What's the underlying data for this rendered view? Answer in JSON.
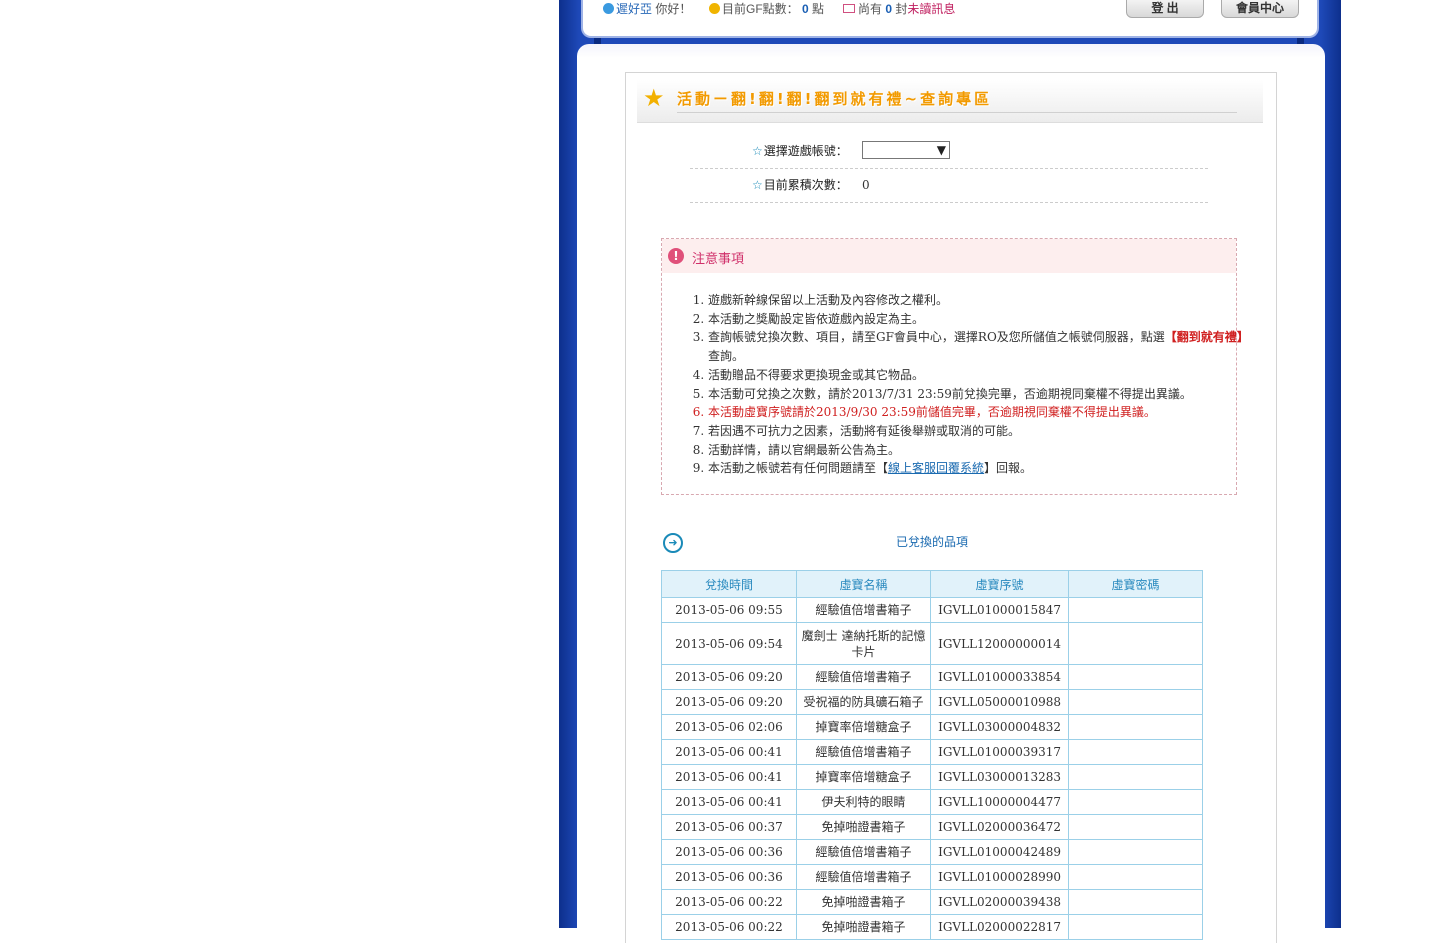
{
  "topbar": {
    "username": "遲好亞",
    "greeting": "你好！",
    "points_label": "目前GF點數：",
    "points_value": "0",
    "points_unit": "點",
    "mail_prefix": "尚有",
    "mail_count": "0",
    "mail_unit": "封",
    "mail_unread": "未讀訊息",
    "logout_label": "登 出",
    "member_center_label": "會員中心"
  },
  "header": {
    "title": "活動ㄧ翻!翻!翻!翻到就有禮~查詢專區"
  },
  "form": {
    "account_label": "選擇遊戲帳號：",
    "account_selected": "",
    "count_label": "目前累積次數：",
    "count_value": "0"
  },
  "notice": {
    "title": "注意事項",
    "item1": "遊戲新幹線保留以上活動及內容修改之權利。",
    "item2": "本活動之獎勵設定皆依遊戲內設定為主。",
    "item3_a": "查詢帳號兌換次數、項目，請至GF會員中心，選擇RO及您所儲值之帳號伺服器，點選",
    "item3_b": "【翻到就有禮】",
    "item3_c": "查詢。",
    "item4": "活動贈品不得要求更換現金或其它物品。",
    "item5": "本活動可兌換之次數，請於2013/7/31 23:59前兌換完畢，否逾期視同棄權不得提出異議。",
    "item6": "本活動虛寶序號請於2013/9/30 23:59前儲值完畢，否逾期視同棄權不得提出異議。",
    "item7": "若因遇不可抗力之因素，活動將有延後舉辦或取消的可能。",
    "item8": "活動詳情，請以官網最新公告為主。",
    "item9_a": "本活動之帳號若有任何問題請至【",
    "item9_link": "線上客服回覆系統",
    "item9_b": "】回報。"
  },
  "redeemed": {
    "title": "已兌換的品項",
    "columns": [
      "兌換時間",
      "虛寶名稱",
      "虛寶序號",
      "虛寶密碼"
    ],
    "rows": [
      {
        "time": "2013-05-06 09:55",
        "name": "經驗值倍增書箱子",
        "serial": "IGVLL01000015847",
        "password": ""
      },
      {
        "time": "2013-05-06 09:54",
        "name": "魔劍士 達納托斯的記憶卡片",
        "serial": "IGVLL12000000014",
        "password": ""
      },
      {
        "time": "2013-05-06 09:20",
        "name": "經驗值倍增書箱子",
        "serial": "IGVLL01000033854",
        "password": ""
      },
      {
        "time": "2013-05-06 09:20",
        "name": "受祝福的防具礦石箱子",
        "serial": "IGVLL05000010988",
        "password": ""
      },
      {
        "time": "2013-05-06 02:06",
        "name": "掉寶率倍增糖盒子",
        "serial": "IGVLL03000004832",
        "password": ""
      },
      {
        "time": "2013-05-06 00:41",
        "name": "經驗值倍增書箱子",
        "serial": "IGVLL01000039317",
        "password": ""
      },
      {
        "time": "2013-05-06 00:41",
        "name": "掉寶率倍增糖盒子",
        "serial": "IGVLL03000013283",
        "password": ""
      },
      {
        "time": "2013-05-06 00:41",
        "name": "伊夫利特的眼睛",
        "serial": "IGVLL10000004477",
        "password": ""
      },
      {
        "time": "2013-05-06 00:37",
        "name": "免掉啪證書箱子",
        "serial": "IGVLL02000036472",
        "password": ""
      },
      {
        "time": "2013-05-06 00:36",
        "name": "經驗值倍增書箱子",
        "serial": "IGVLL01000042489",
        "password": ""
      },
      {
        "time": "2013-05-06 00:36",
        "name": "經驗值倍增書箱子",
        "serial": "IGVLL01000028990",
        "password": ""
      },
      {
        "time": "2013-05-06 00:22",
        "name": "免掉啪證書箱子",
        "serial": "IGVLL02000039438",
        "password": ""
      },
      {
        "time": "2013-05-06 00:22",
        "name": "免掉啪證書箱子",
        "serial": "IGVLL02000022817",
        "password": ""
      }
    ]
  },
  "colors": {
    "frame_blue": "#1e49b8",
    "title_orange": "#f29a00",
    "table_header_bg": "#e1f2fa",
    "table_border": "#9bd0e8",
    "notice_red": "#d02020"
  },
  "icons": {
    "user": "smile-icon",
    "coin": "coin-icon",
    "mail": "envelope-icon",
    "title": "stars-icon",
    "notice": "exclamation-icon",
    "section": "arrow-right-circle-icon"
  }
}
